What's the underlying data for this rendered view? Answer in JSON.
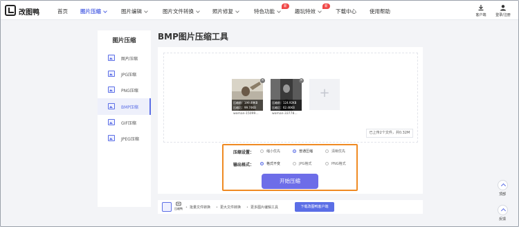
{
  "header": {
    "brand": "改图鸭",
    "nav": [
      {
        "label": "首页"
      },
      {
        "label": "图片压缩"
      },
      {
        "label": "图片编辑"
      },
      {
        "label": "图片文件转换"
      },
      {
        "label": "照片修复"
      },
      {
        "label": "特色功能"
      },
      {
        "label": "趣玩特效"
      },
      {
        "label": "下载中心"
      },
      {
        "label": "使用帮助"
      }
    ],
    "badge_new": "新",
    "client_label": "客户端",
    "login_label": "登录/注册"
  },
  "sidebar": {
    "title": "图片压缩",
    "items": [
      {
        "label": "图片压缩"
      },
      {
        "label": "JPG压缩"
      },
      {
        "label": "PNG压缩"
      },
      {
        "label": "BMP压缩"
      },
      {
        "label": "GIF压缩"
      },
      {
        "label": "JPEG压缩"
      }
    ]
  },
  "main": {
    "title": "BMP图片压缩工具",
    "files": [
      {
        "before": "压缩前：199.49KB",
        "after": "压缩后：99.74KB",
        "name": "woman-15099..."
      },
      {
        "before": "压缩前：124.92KB",
        "after": "压缩后：62.46KB",
        "name": "woman-33778..."
      }
    ],
    "add_symbol": "+",
    "remove_symbol": "×",
    "summary": "已上传2个文件，共0.32M",
    "settings": {
      "compress_label": "压缩设置：",
      "compress_options": [
        "缩小优先",
        "普通压缩",
        "清晰优先"
      ],
      "compress_selected": 1,
      "format_label": "输出格式：",
      "format_options": [
        "格式不变",
        "JPG格式",
        "PNG格式"
      ],
      "format_selected": 0
    },
    "start_button": "开始压缩"
  },
  "bottom_bar": {
    "app_label": "压缩鸭",
    "links": [
      "批量文件转换",
      "更大文件转换",
      "更多图片编辑工具"
    ],
    "download_button": "下载改图鸭客户端"
  },
  "floating": {
    "top_label": "顶部",
    "feedback_label": "反馈"
  },
  "colors": {
    "accent": "#5b6ee6",
    "highlight_border": "#ef8a22",
    "start_button": "#6d6de8",
    "badge": "#f04646"
  }
}
